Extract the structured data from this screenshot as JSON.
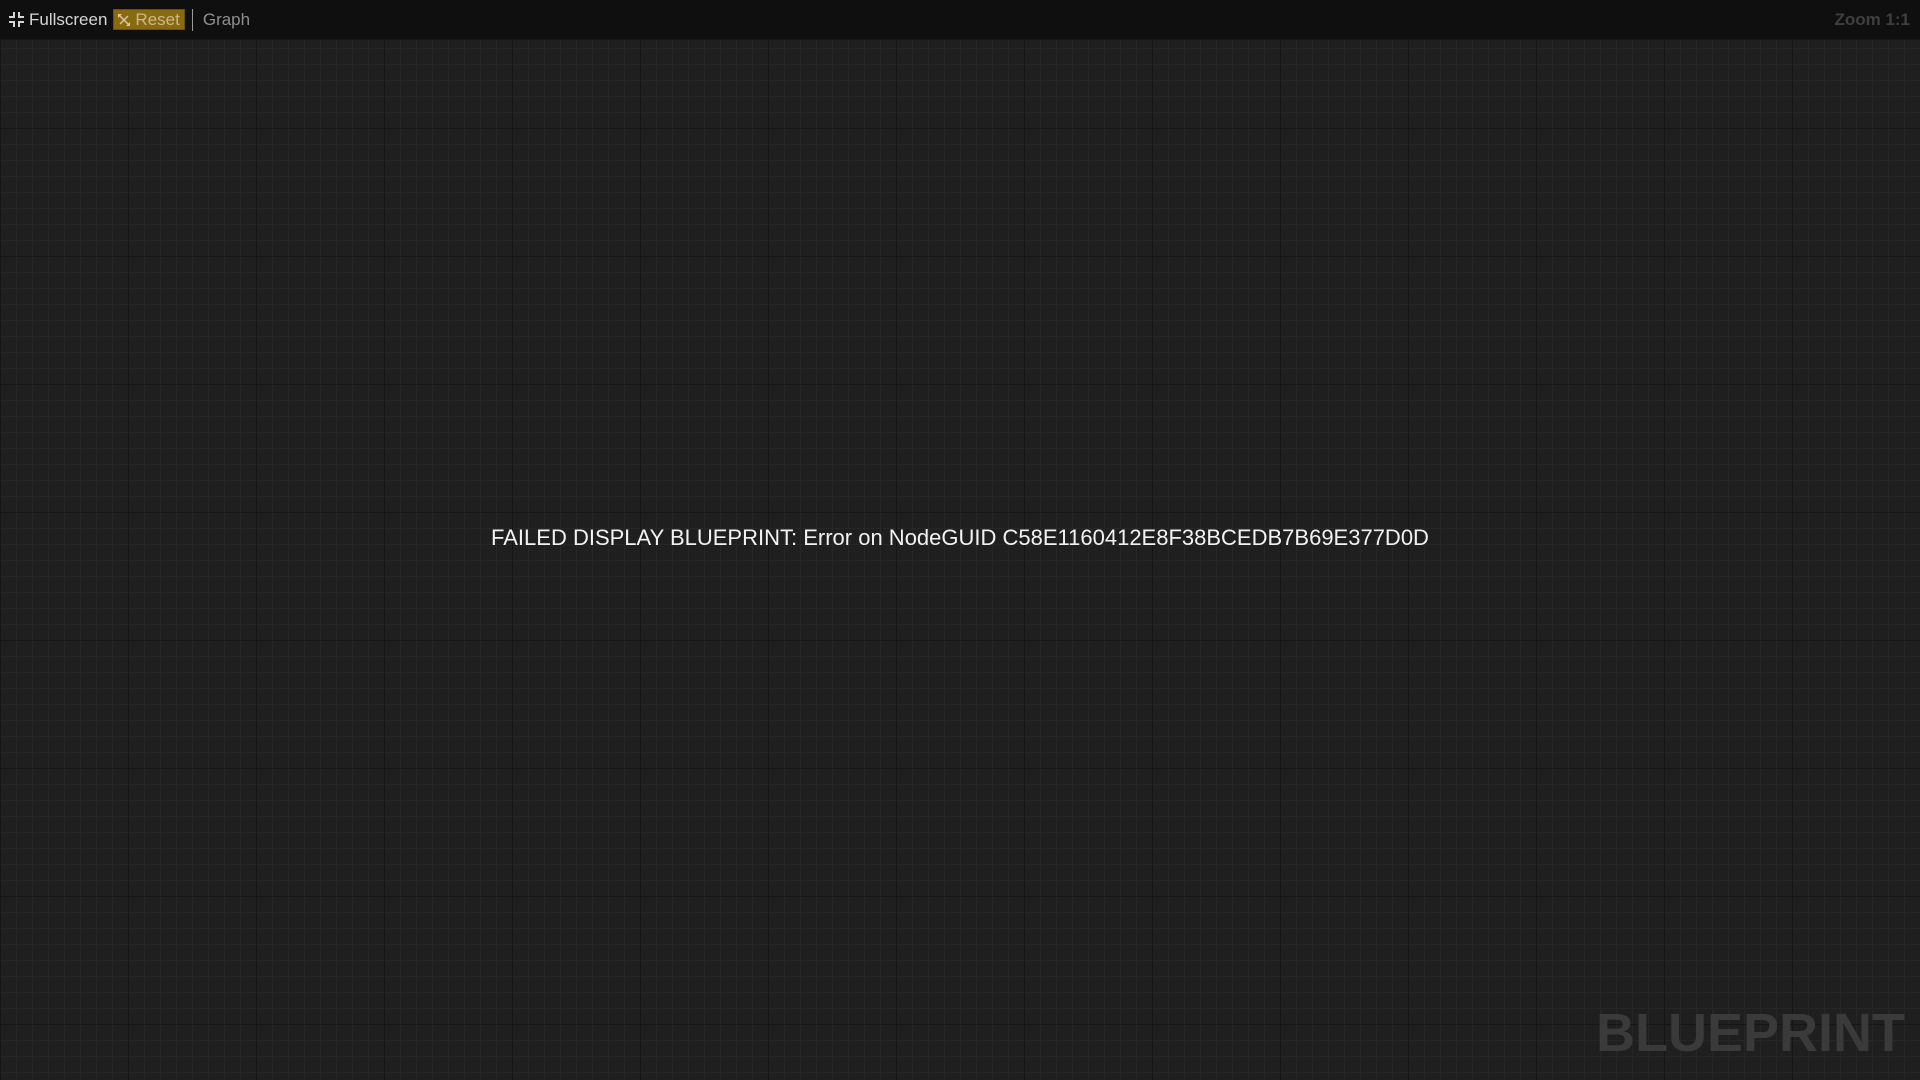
{
  "toolbar": {
    "fullscreen_label": "Fullscreen",
    "fullscreen_icon": "fullscreen-collapse-icon",
    "reset_label": "Reset",
    "reset_icon": "reset-arrows-icon",
    "graph_label": "Graph",
    "zoom_label": "Zoom 1:1"
  },
  "canvas": {
    "error_message": "FAILED DISPLAY BLUEPRINT: Error on NodeGUID C58E1160412E8F38BCEDB7B69E377D0D",
    "watermark": "BLUEPRINT"
  },
  "colors": {
    "toolbar_bg": "#0f0f0f",
    "canvas_bg": "#1f1f1f",
    "reset_button_bg": "#8a6a10",
    "grid_major": "#151515",
    "grid_minor": "#262626",
    "error_text": "#f2f2f2",
    "watermark_text": "#3a3a3a"
  }
}
